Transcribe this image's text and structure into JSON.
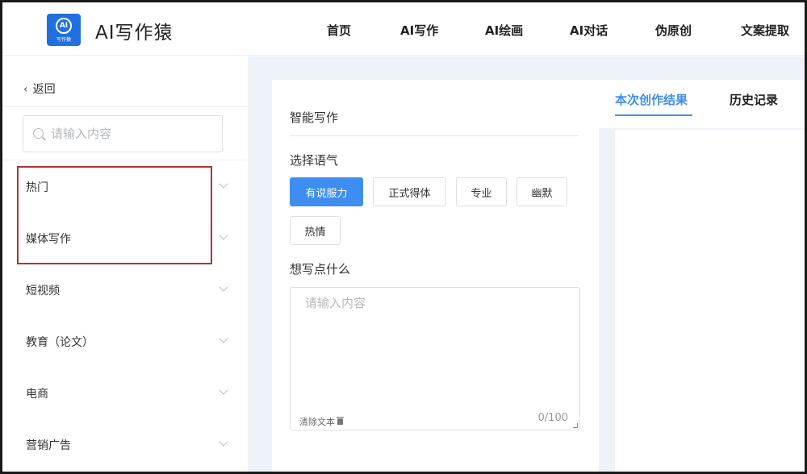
{
  "header": {
    "logo_text": "AI",
    "logo_sub": "写作猿",
    "app_title": "AI写作猿",
    "nav": [
      "首页",
      "AI写作",
      "AI绘画",
      "AI对话",
      "伪原创",
      "文案提取"
    ]
  },
  "sidebar": {
    "back_label": "返回",
    "search_placeholder": "请输入内容",
    "categories": [
      "热门",
      "媒体写作",
      "短视频",
      "教育（论文）",
      "电商",
      "营销广告"
    ]
  },
  "editor": {
    "section_title": "智能写作",
    "tone_label": "选择语气",
    "tones": [
      "有说服力",
      "正式得体",
      "专业",
      "幽默",
      "热情"
    ],
    "selected_tone": "有说服力",
    "input_label": "想写点什么",
    "input_placeholder": "请输入内容",
    "input_value": "",
    "clear_label": "清除文本",
    "counter": "0/100"
  },
  "results": {
    "tabs": [
      "本次创作结果",
      "历史记录"
    ],
    "active_tab": "本次创作结果"
  },
  "colors": {
    "accent": "#3d8ef0",
    "logo_bg": "#1f6fe0",
    "highlight_border": "#b23232",
    "main_bg": "#eef3f9"
  }
}
